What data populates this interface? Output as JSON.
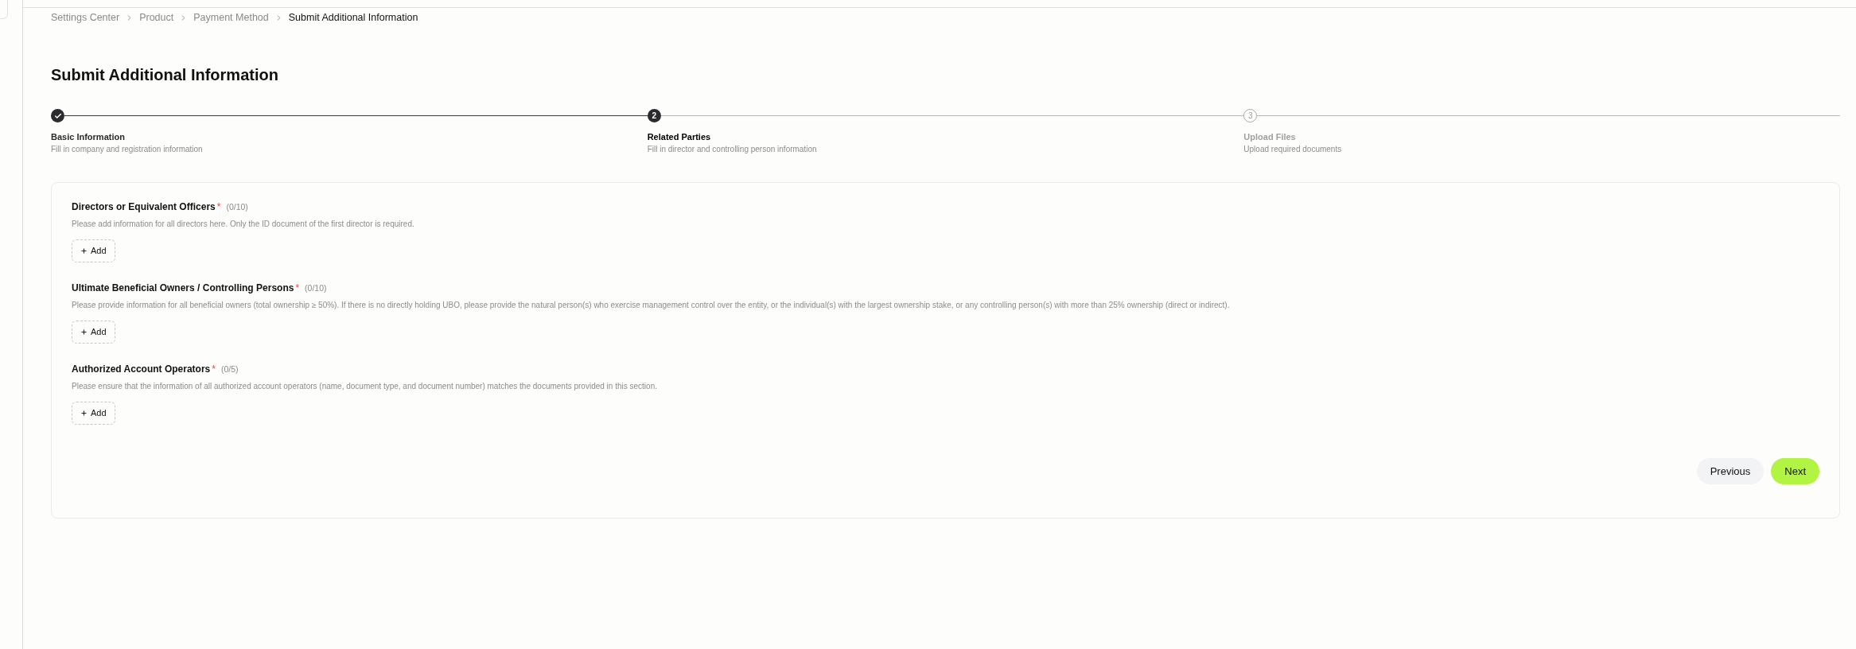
{
  "breadcrumb": [
    {
      "label": "Settings Center",
      "current": false
    },
    {
      "label": "Product",
      "current": false
    },
    {
      "label": "Payment Method",
      "current": false
    },
    {
      "label": "Submit Additional Information",
      "current": true
    }
  ],
  "page_title": "Submit Additional Information",
  "steps": [
    {
      "title": "Basic Information",
      "description": "Fill in company and registration information",
      "completed": true,
      "selected": false
    },
    {
      "number": "2",
      "title": "Related Parties",
      "description": "Fill in director and controlling person information",
      "completed": false,
      "selected": true
    },
    {
      "number": "3",
      "title": "Upload Files",
      "description": "Upload required documents",
      "completed": false,
      "selected": false
    }
  ],
  "sections": [
    {
      "title": "Directors or Equivalent Officers",
      "required_mark": "*",
      "count": "(0/10)",
      "description": "Please add information for all directors here. Only the ID document of the first director is required.",
      "add_label": "Add"
    },
    {
      "title": "Ultimate Beneficial Owners / Controlling Persons",
      "required_mark": "*",
      "count": "(0/10)",
      "description": "Please provide information for all beneficial owners (total ownership ≥ 50%). If there is no directly holding UBO, please provide the natural person(s) who exercise management control over the entity, or the individual(s) with the largest ownership stake, or any controlling person(s) with more than 25% ownership (direct or indirect).",
      "add_label": "Add"
    },
    {
      "title": "Authorized Account Operators",
      "required_mark": "*",
      "count": "(0/5)",
      "description": "Please ensure that the information of all authorized account operators (name, document type, and document number) matches the documents provided in this section.",
      "add_label": "Add"
    }
  ],
  "actions": [
    {
      "label": "Previous",
      "kind": "secondary"
    },
    {
      "label": "Next",
      "kind": "primary"
    }
  ]
}
